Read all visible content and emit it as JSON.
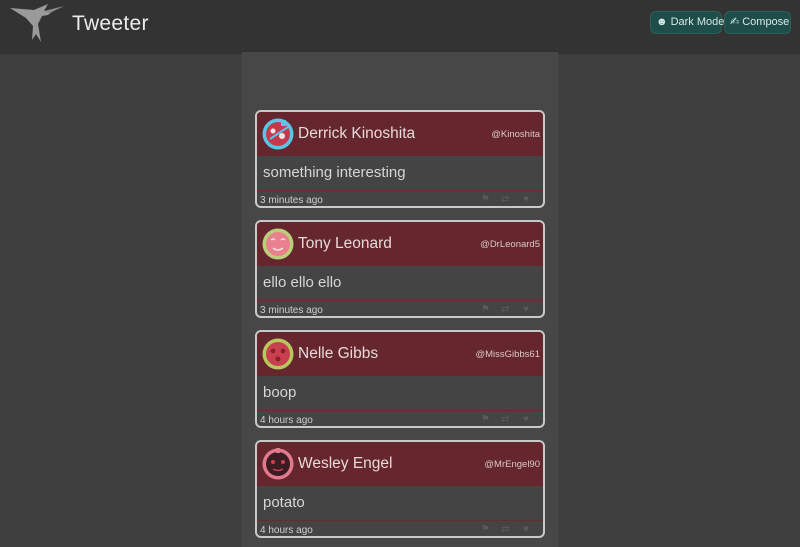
{
  "app": {
    "title": "Tweeter",
    "logo_icon": "hummingbird-icon"
  },
  "nav": {
    "dark_mode": {
      "icon": "moon-icon",
      "glyph": "☻",
      "label": "Dark Mode"
    },
    "compose": {
      "icon": "writing-hand-icon",
      "glyph": "✍",
      "label": "Compose"
    }
  },
  "colors": {
    "background": "#404040",
    "navbar": "#333333",
    "tweet_header": "#65262d",
    "button": "#1f4d4a"
  },
  "tweets": [
    {
      "name": "Derrick Kinoshita",
      "handle": "@Kinoshita",
      "text": "something interesting",
      "time": "3 minutes ago",
      "avatar": "avatar-blue"
    },
    {
      "name": "Tony Leonard",
      "handle": "@DrLeonard5",
      "text": "ello ello ello",
      "time": "3 minutes ago",
      "avatar": "avatar-pink"
    },
    {
      "name": "Nelle Gibbs",
      "handle": "@MissGibbs61",
      "text": "boop",
      "time": "4 hours ago",
      "avatar": "avatar-green"
    },
    {
      "name": "Wesley Engel",
      "handle": "@MrEngel90",
      "text": "potato",
      "time": "4 hours ago",
      "avatar": "avatar-dark"
    }
  ],
  "tweet_actions": [
    "flag-icon",
    "retweet-icon",
    "heart-icon"
  ]
}
